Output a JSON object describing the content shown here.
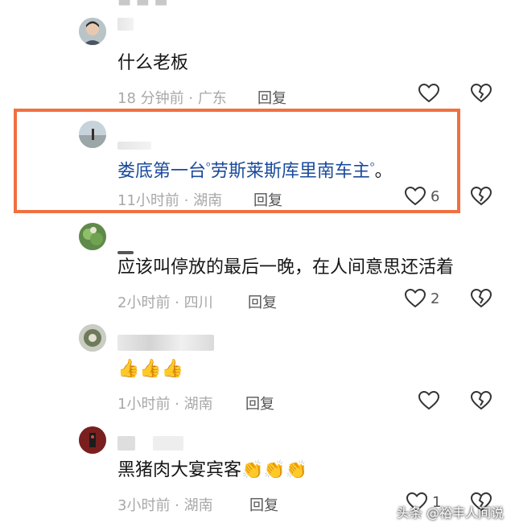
{
  "comments": [
    {
      "text": "什么老板",
      "time": "18 分钟前",
      "location": "广东",
      "reply_label": "回复",
      "like_count": ""
    },
    {
      "text_parts": [
        "娄底第一台",
        "劳斯莱斯库里南车主",
        "。"
      ],
      "time": "11小时前",
      "location": "湖南",
      "reply_label": "回复",
      "like_count": "6"
    },
    {
      "text": "应该叫停放的最后一晚，在人间意思还活着",
      "time": "2小时前",
      "location": "四川",
      "reply_label": "回复",
      "like_count": "2"
    },
    {
      "text": "👍👍👍",
      "time": "1小时前",
      "location": "湖南",
      "reply_label": "回复",
      "like_count": ""
    },
    {
      "text": "黑猪肉大宴宾客👏👏👏",
      "time": "3小时前",
      "location": "湖南",
      "reply_label": "回复",
      "like_count": "1"
    }
  ],
  "separator": " · ",
  "watermark": "头条 @裕丰人间说",
  "colors": {
    "highlight": "#f07040",
    "link": "#1b4a9c"
  }
}
